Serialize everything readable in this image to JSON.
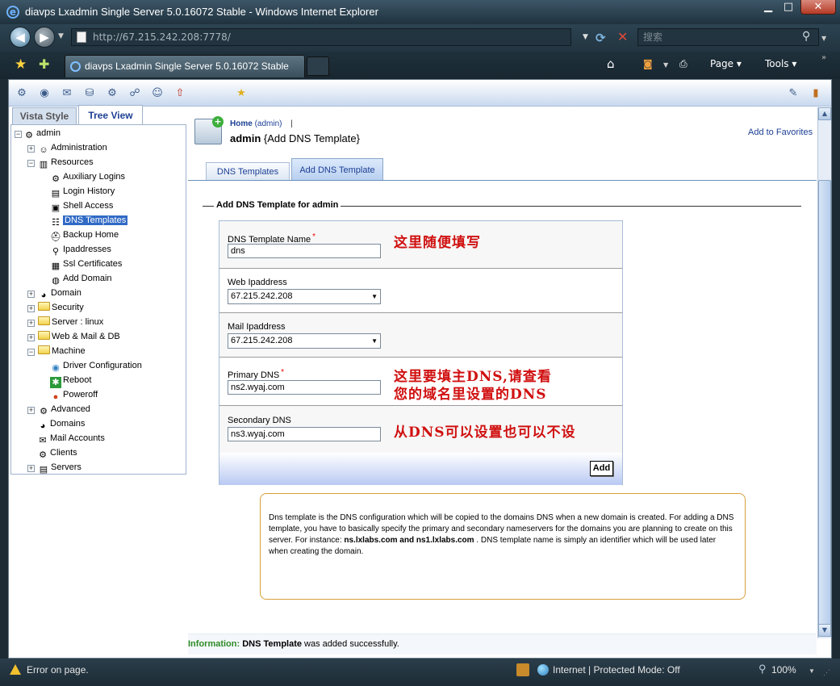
{
  "window": {
    "title": "diavps Lxadmin Single Server 5.0.16072 Stable - Windows Internet Explorer",
    "min": "▁",
    "max": "□",
    "close": "✕"
  },
  "browser": {
    "url": "http://67.215.242.208:7778/",
    "search_placeholder": "搜索",
    "tab_title": "diavps Lxadmin Single Server 5.0.16072 Stable",
    "page_menu": "Page ▾",
    "tools_menu": "Tools ▾"
  },
  "left_tabs": {
    "vista": "Vista Style",
    "tree": "Tree View"
  },
  "tree": {
    "root": "admin",
    "administration": "Administration",
    "resources": "Resources",
    "resources_children": {
      "auxiliary": "Auxiliary Logins",
      "login_history": "Login History",
      "shell": "Shell Access",
      "dns_templates": "DNS Templates",
      "backup": "Backup Home",
      "ipaddresses": "Ipaddresses",
      "ssl": "Ssl Certificates",
      "add_domain": "Add Domain"
    },
    "domain": "Domain",
    "security": "Security",
    "server": "Server  : linux",
    "webmail": "Web & Mail & DB",
    "machine": "Machine",
    "machine_children": {
      "driver": "Driver Configuration",
      "reboot": "Reboot",
      "poweroff": "Poweroff"
    },
    "advanced": "Advanced",
    "domains": "Domains",
    "mail_accounts": "Mail Accounts",
    "clients": "Clients",
    "servers": "Servers"
  },
  "header": {
    "home": "Home",
    "home_user": "(admin)",
    "sep": "|",
    "title_user": "admin",
    "title_rest": " {Add DNS Template}",
    "add_favorites": "Add to Favorites"
  },
  "subtabs": {
    "dns_templates": "DNS Templates",
    "add_dns_template": "Add DNS Template"
  },
  "form": {
    "legend": "Add DNS Template for admin",
    "required_mark": "*",
    "name_label": "DNS Template Name",
    "name_value": "dns",
    "web_label": "Web Ipaddress",
    "web_value": "67.215.242.208",
    "mail_label": "Mail Ipaddress",
    "mail_value": "67.215.242.208",
    "primary_label": "Primary DNS",
    "primary_value": "ns2.wyaj.com",
    "secondary_label": "Secondary DNS",
    "secondary_value": "ns3.wyaj.com",
    "add_button": "Add"
  },
  "annotations": {
    "note1": "这里随便填写",
    "note2_line1": "这里要填主DNS,请查看",
    "note2_line2": "您的域名里设置的DNS",
    "note3": "从DNS可以设置也可以不设"
  },
  "help": {
    "text_1": "Dns template is the DNS configuration which will be copied to the domains DNS when a new domain is created. For adding a DNS template, you have to basically specify the primary and secondary nameservers for the domains you are planning to create on this server. For instance: ",
    "bold": "ns.lxlabs.com and ns1.lxlabs.com",
    "text_2": " . DNS template name is simply an identifier which will be used later when creating the domain."
  },
  "info": {
    "label": "Information:",
    "bold": "DNS Template",
    "rest": " was added successfully."
  },
  "status": {
    "error": "Error on page.",
    "zone": "Internet | Protected Mode: Off",
    "zoom": "100%"
  },
  "colors": {
    "annotation_red": "#d01010",
    "link_blue": "#1c3f94",
    "info_green": "#2e8b27",
    "selection_blue": "#316ac5"
  }
}
